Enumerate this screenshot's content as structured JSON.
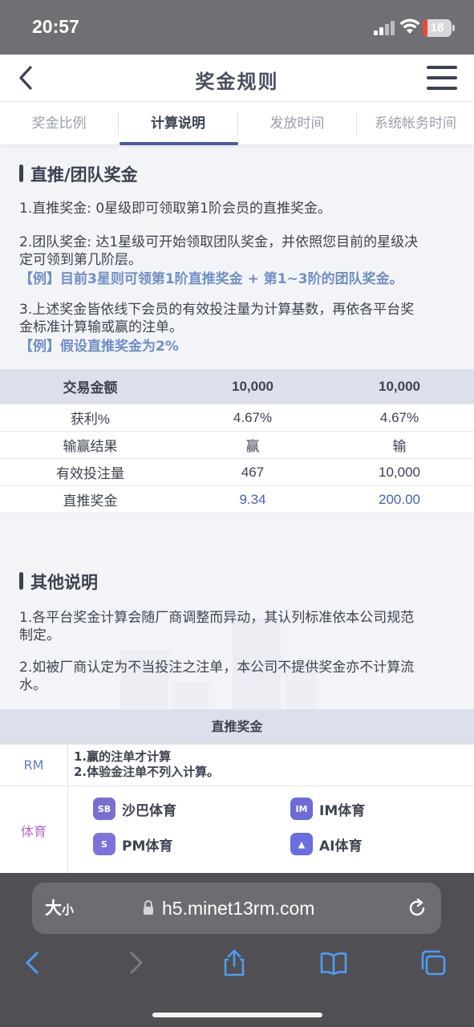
{
  "status_bar": {
    "time": "20:57",
    "battery_level": "18",
    "battery_color": "#e64a3c"
  },
  "header": {
    "title": "奖金规则"
  },
  "tabs": [
    {
      "label": "奖金比例",
      "active": false
    },
    {
      "label": "计算说明",
      "active": true
    },
    {
      "label": "发放时间",
      "active": false
    },
    {
      "label": "系统帐务时间",
      "active": false
    }
  ],
  "section1": {
    "title": "直推/团队奖金",
    "p1": "1.直推奖金: 0星级即可领取第1阶会员的直推奖金。",
    "p2_line1": "2.团队奖金: 达1星级可开始领取团队奖金，并依照您目前的星级决",
    "p2_line2": "定可领到第几阶层。",
    "example1": "【例】目前3星则可领第1阶直推奖金 + 第1~3阶的团队奖金。",
    "p3_line1": "3.上述奖金皆依线下会员的有效投注量为计算基数，再依各平台奖",
    "p3_line2": "金标准计算输或赢的注单。",
    "example2": "【例】假设直推奖金为2%"
  },
  "calc_table": {
    "header": [
      "交易金额",
      "10,000",
      "10,000"
    ],
    "rows": [
      [
        "获利%",
        "4.67%",
        "4.67%"
      ],
      [
        "输赢结果",
        "赢",
        "输"
      ],
      [
        "有效投注量",
        "467",
        "10,000"
      ],
      [
        "直推奖金",
        "9.34",
        "200.00"
      ]
    ]
  },
  "section2": {
    "title": "其他说明",
    "p1_line1": "1.各平台奖金计算会随厂商调整而异动，其认列标准依本公司规范",
    "p1_line2": "制定。",
    "p2_line1": "2.如被厂商认定为不当投注之注单，本公司不提供奖金亦不计算流",
    "p2_line2": "水。"
  },
  "bonus_table": {
    "header": "直推奖金",
    "rm_label": "RM",
    "rm_label_color": "#5b7fc4",
    "rm_rule1": "1.赢的注单才计算",
    "rm_rule2": "2.体验金注单不列入计算。",
    "sports_label": "体育",
    "sports_label_color": "#b86ac8",
    "platforms": [
      {
        "name": "沙巴体育",
        "icon": "saba-logo"
      },
      {
        "name": "IM体育",
        "icon": "im-logo"
      },
      {
        "name": "PM体育",
        "icon": "pm-logo"
      },
      {
        "name": "AI体育",
        "icon": "ai-logo"
      }
    ]
  },
  "browser": {
    "text_size_main": "大",
    "text_size_small": "小",
    "url": "h5.minet13rm.com"
  }
}
